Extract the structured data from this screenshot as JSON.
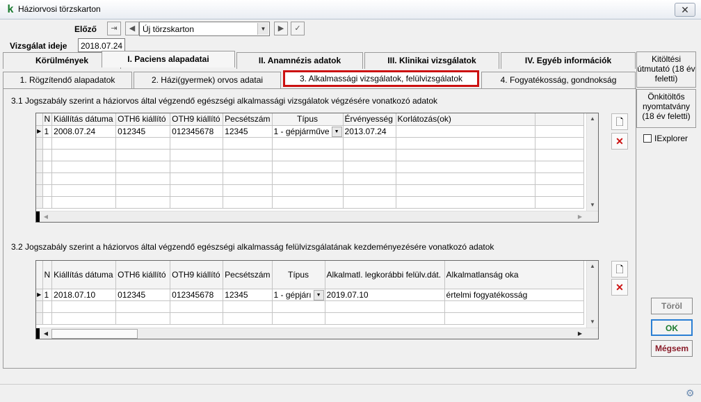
{
  "window": {
    "title": "Háziorvosi törzskarton",
    "close_glyph": "✕",
    "app_icon": "k"
  },
  "toolbar": {
    "prev_label": "Előző",
    "record_select": "Új törzskarton",
    "icons": {
      "import": "import-icon",
      "left": "arrow-left-icon",
      "right": "arrow-right-icon",
      "check": "check-icon"
    }
  },
  "exam_date": {
    "label": "Vizsgálat ideje",
    "value": "2018.07.24"
  },
  "tabs_top": [
    {
      "label": "Körülmények"
    },
    {
      "label": "I. Paciens alapadatai"
    },
    {
      "label": "II. Anamnézis adatok"
    },
    {
      "label": "III. Klinikai vizsgálatok"
    },
    {
      "label": "IV. Egyéb információk"
    }
  ],
  "tabs_sub": [
    {
      "label": "1. Rögzítendő alapadatok"
    },
    {
      "label": "2. Házi(gyermek) orvos adatai"
    },
    {
      "label": "3. Alkalmassági vizsgálatok, felülvizsgálatok"
    },
    {
      "label": "4. Fogyatékosság, gondnokság"
    }
  ],
  "side_panel": {
    "guide": "Kitöltési útmutató (18 év feletti)",
    "selfform": "Önkitöltős nyomtatvány (18 év feletti)",
    "iexplorer_label": "IExplorer",
    "iexplorer_checked": false
  },
  "section1": {
    "title": "3.1 Jogszabály szerint a háziorvos által végzendő egészségi alkalmassági vizsgálatok végzésére vonatkozó adatok",
    "columns": [
      "N",
      "Kiállítás dátuma",
      "OTH6 kiállító",
      "OTH9 kiállító",
      "Pecsétszám",
      "Típus",
      "Érvényesség",
      "Korlátozás(ok)"
    ],
    "rows": [
      {
        "n": "1",
        "date": "2008.07.24",
        "oth6": "012345",
        "oth9": "012345678",
        "seal": "12345",
        "type": "1 - gépjárműve",
        "validity": "2013.07.24",
        "limit": ""
      }
    ]
  },
  "section2": {
    "title": "3.2 Jogszabály szerint a háziorvos által végzendő egészségi alkalmasság felülvizsgálatának kezdeményezésére vonatkozó adatok",
    "columns": [
      "N",
      "Kiállítás dátuma",
      "OTH6 kiállító",
      "OTH9 kiállító",
      "Pecsétszám",
      "Típus",
      "Alkalmatl. legkorábbi felülv.dát.",
      "Alkalmatlanság oka"
    ],
    "rows": [
      {
        "n": "1",
        "date": "2018.07.10",
        "oth6": "012345",
        "oth9": "012345678",
        "seal": "12345",
        "type": "1 - gépjárı",
        "earliest": "2019.07.10",
        "reason": "értelmi fogyatékosság"
      }
    ]
  },
  "buttons": {
    "delete": "Töröl",
    "ok": "OK",
    "cancel": "Mégsem"
  },
  "colors": {
    "ok_text": "#1a7a2e",
    "cancel_text": "#8a1d2a",
    "delete_text": "#7a7a7a",
    "active_tab_border": "#cc1111"
  }
}
